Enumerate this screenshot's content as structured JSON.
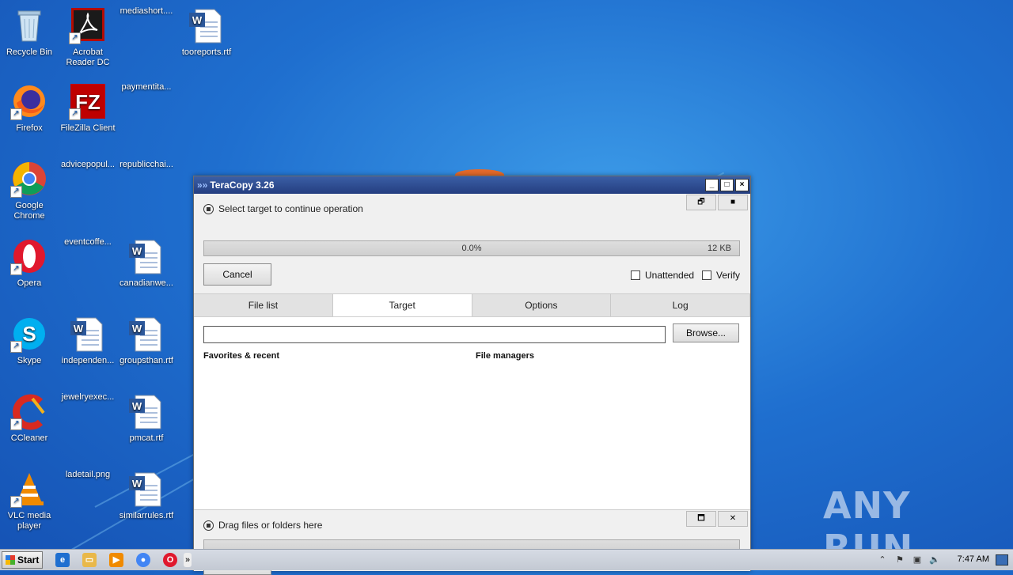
{
  "desktop": {
    "icons": [
      {
        "label": "Recycle Bin",
        "icon": "recycle-bin-icon"
      },
      {
        "label": "Acrobat Reader DC",
        "icon": "acrobat-icon"
      },
      {
        "label": "mediashort....",
        "icon": "file-icon"
      },
      {
        "label": "tooreports.rtf",
        "icon": "word-doc-icon"
      },
      {
        "label": "Firefox",
        "icon": "firefox-icon"
      },
      {
        "label": "FileZilla Client",
        "icon": "filezilla-icon"
      },
      {
        "label": "paymentita...",
        "icon": "file-icon"
      },
      {
        "label": "Google Chrome",
        "icon": "chrome-icon"
      },
      {
        "label": "advicepopul...",
        "icon": "image-icon"
      },
      {
        "label": "republicchai...",
        "icon": "file-icon"
      },
      {
        "label": "Opera",
        "icon": "opera-icon"
      },
      {
        "label": "eventcoffe...",
        "icon": "image-icon"
      },
      {
        "label": "canadianwe...",
        "icon": "word-doc-icon"
      },
      {
        "label": "Skype",
        "icon": "skype-icon"
      },
      {
        "label": "independen...",
        "icon": "word-doc-icon"
      },
      {
        "label": "groupsthan.rtf",
        "icon": "word-doc-icon"
      },
      {
        "label": "CCleaner",
        "icon": "ccleaner-icon"
      },
      {
        "label": "jewelryexec...",
        "icon": "file-icon"
      },
      {
        "label": "pmcat.rtf",
        "icon": "word-doc-icon"
      },
      {
        "label": "VLC media player",
        "icon": "vlc-icon"
      },
      {
        "label": "ladetail.png",
        "icon": "file-icon"
      },
      {
        "label": "similarrules.rtf",
        "icon": "word-doc-icon"
      }
    ]
  },
  "window": {
    "title": "TeraCopy 3.26",
    "controls": [
      "_",
      "□",
      "×"
    ],
    "status_text": "Select target to continue operation",
    "progress_percent": "0.0%",
    "progress_size": "12 KB",
    "progress_fraction": 0.0,
    "cancel_label": "Cancel",
    "unattended_label": "Unattended",
    "verify_label": "Verify",
    "tabs": [
      "File list",
      "Target",
      "Options",
      "Log"
    ],
    "active_tab": "Target",
    "browse_label": "Browse...",
    "path_value": "",
    "favorites_heading": "Favorites & recent",
    "file_managers_heading": "File managers",
    "bottom_status": "Drag files or folders here"
  },
  "taskbar": {
    "start_label": "Start",
    "clock": "7:47 AM"
  },
  "watermark": "ANY RUN"
}
